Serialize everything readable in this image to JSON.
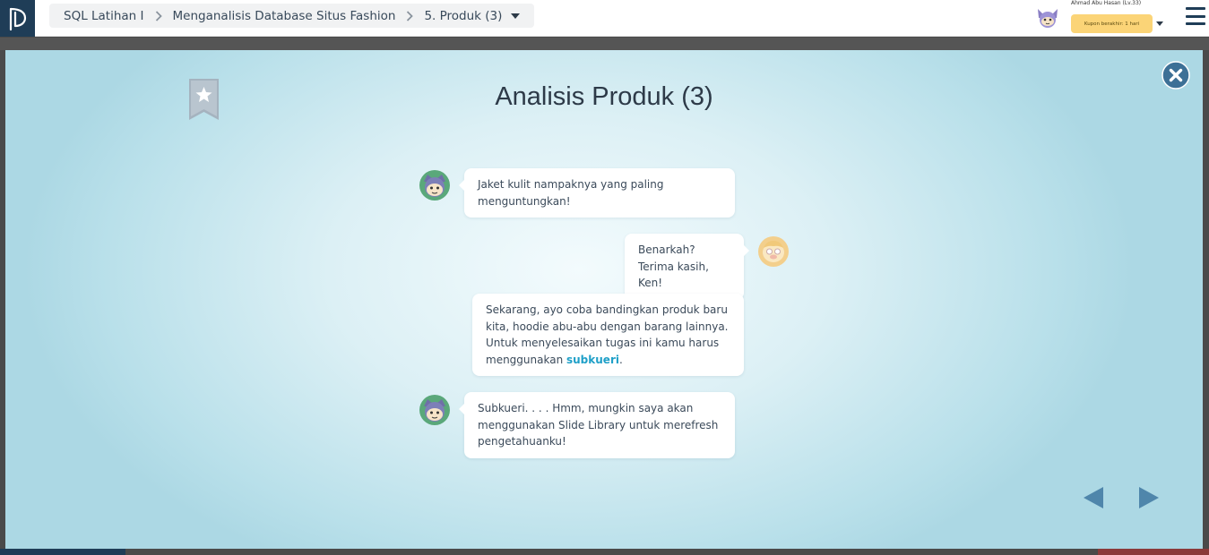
{
  "breadcrumb": {
    "course": "SQL Latihan I",
    "chapter": "Menganalisis Database Situs Fashion",
    "page": "5. Produk (3)"
  },
  "user": {
    "name": "Ahmad Abu Hasan (Lv.33)",
    "coupon": "Kupon berakhir: 1 hari"
  },
  "lesson": {
    "title": "Analisis Produk (3)",
    "messages": [
      {
        "speaker": "ken",
        "side": "left",
        "text": "Jaket kulit nampaknya yang paling menguntungkan!"
      },
      {
        "speaker": "mentor",
        "side": "right",
        "text_line1": "Benarkah?",
        "text_line2": "Terima kasih, Ken!"
      },
      {
        "speaker": "mentor",
        "side": "center",
        "text_before": "Sekarang, ayo coba bandingkan produk baru kita, hoodie abu-abu dengan barang lainnya. Untuk menyelesaikan tugas ini kamu harus menggunakan ",
        "text_highlight": "subkueri",
        "text_after": "."
      },
      {
        "speaker": "ken",
        "side": "left",
        "text": "Subkueri. . . . Hmm, mungkin saya akan menggunakan Slide Library untuk merefresh pengetahuanku!"
      }
    ]
  },
  "colors": {
    "brand": "#1f3d57",
    "accent": "#1fa0c8",
    "coupon": "#fbd477",
    "nav_arrow": "#4f86ab"
  },
  "icons": [
    "logo-icon",
    "chevron-right-icon",
    "caret-down-icon",
    "user-avatar-icon",
    "hamburger-menu-icon",
    "bookmark-star-icon",
    "close-icon",
    "ken-avatar-icon",
    "mentor-avatar-icon",
    "prev-arrow-icon",
    "next-arrow-icon"
  ]
}
